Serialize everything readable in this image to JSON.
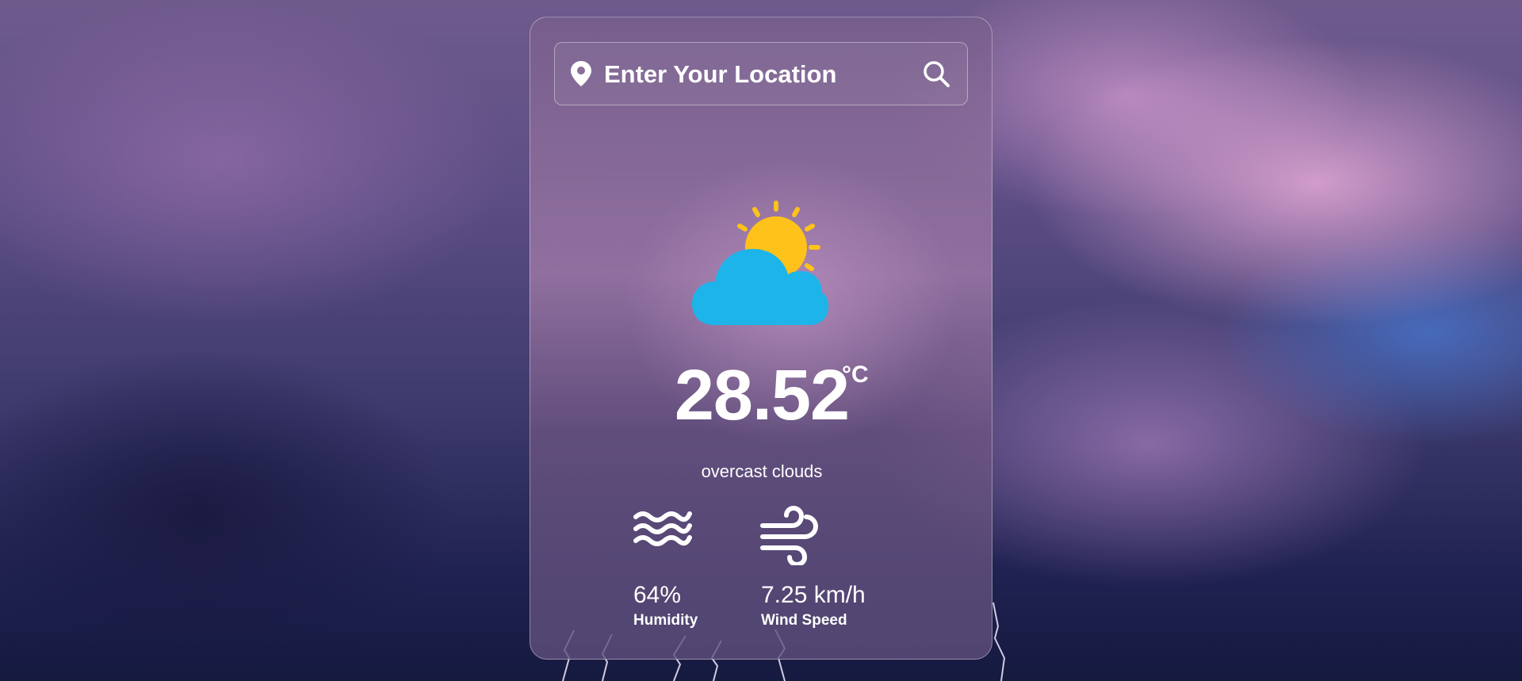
{
  "search": {
    "placeholder": "Enter Your Location",
    "location_icon": "map-pin-icon",
    "search_icon": "search-icon"
  },
  "weather": {
    "icon": "partly-cloudy-icon",
    "temperature": "28.52",
    "unit": "°C",
    "description": "overcast clouds"
  },
  "stats": {
    "humidity": {
      "icon": "waves-icon",
      "value": "64%",
      "label": "Humidity"
    },
    "wind": {
      "icon": "wind-icon",
      "value": "7.25 km/h",
      "label": "Wind Speed"
    }
  },
  "colors": {
    "sun": "#FFC21A",
    "cloud": "#1DB4EA",
    "text": "#FFFFFF"
  }
}
